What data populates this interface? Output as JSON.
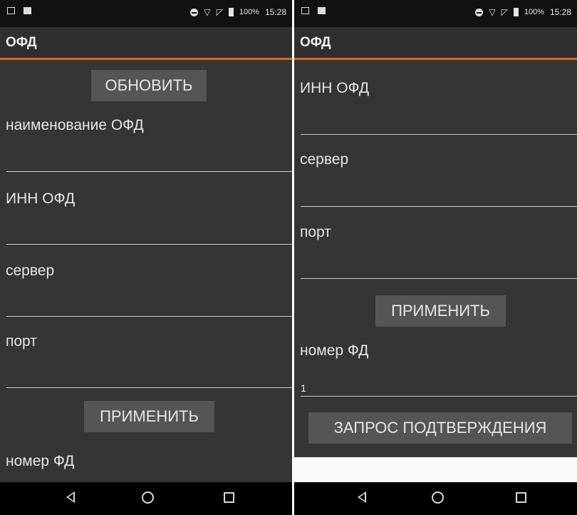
{
  "status_bar": {
    "battery": "100%",
    "time": "15:28"
  },
  "app_title": "ОФД",
  "left_screen": {
    "refresh_button": "ОБНОВИТЬ",
    "fields": [
      {
        "label": "наименование ОФД",
        "value": ""
      },
      {
        "label": "ИНН ОФД",
        "value": ""
      },
      {
        "label": "сервер",
        "value": ""
      },
      {
        "label": "порт",
        "value": ""
      }
    ],
    "apply_button": "ПРИМЕНИТЬ",
    "fd_number_label": "номер ФД"
  },
  "right_screen": {
    "fields": [
      {
        "label": "ИНН ОФД",
        "value": ""
      },
      {
        "label": "сервер",
        "value": ""
      },
      {
        "label": "порт",
        "value": ""
      }
    ],
    "apply_button": "ПРИМЕНИТЬ",
    "fd_number_label": "номер ФД",
    "fd_number_value": "1",
    "confirm_request_button": "ЗАПРОС ПОДТВЕРЖДЕНИЯ"
  },
  "nav_icons": [
    "back-icon",
    "home-icon",
    "recent-apps-icon"
  ],
  "colors": {
    "accent": "#d9661b",
    "background": "#353535",
    "button": "#555555",
    "app_bar": "#2f2f2f"
  }
}
